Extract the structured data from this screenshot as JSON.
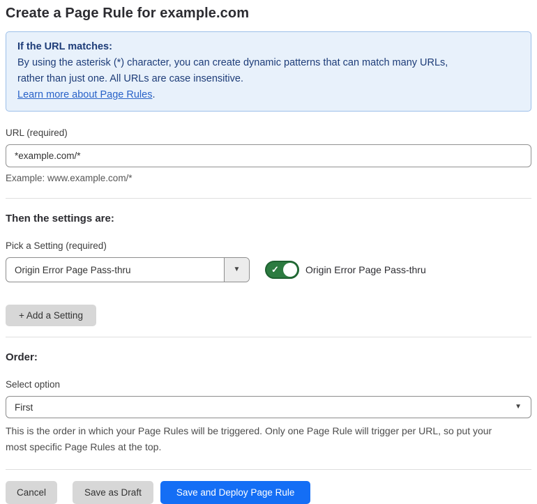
{
  "page": {
    "title": "Create a Page Rule for example.com"
  },
  "info_box": {
    "heading": "If the URL matches:",
    "body_lines": [
      "By using the asterisk (*) character, you can create dynamic patterns that can match many URLs,",
      "rather than just one. All URLs are case insensitive."
    ],
    "link_label": "Learn more about Page Rules",
    "link_suffix": "."
  },
  "url_field": {
    "label": "URL (required)",
    "value": "*example.com/*",
    "helper": "Example: www.example.com/*"
  },
  "settings_section": {
    "heading": "Then the settings are:",
    "picker_label": "Pick a Setting (required)",
    "picker_value": "Origin Error Page Pass-thru",
    "picker_arrow": "▼",
    "toggle": {
      "state": "on",
      "check_glyph": "✓",
      "label": "Origin Error Page Pass-thru"
    },
    "add_setting_label": "+ Add a Setting"
  },
  "order_section": {
    "heading": "Order:",
    "select_label": "Select option",
    "select_value": "First",
    "select_arrow": "▼",
    "helper_lines": [
      "This is the order in which your Page Rules will be triggered. Only one Page Rule will trigger per URL, so put your",
      "most specific Page Rules at the top."
    ]
  },
  "footer": {
    "cancel_label": "Cancel",
    "save_draft_label": "Save as Draft",
    "save_deploy_label": "Save and Deploy Page Rule"
  },
  "colors": {
    "primary_blue": "#146ef5",
    "info_bg": "#e8f1fb",
    "info_border": "#9cbfe9",
    "info_text": "#1d3c78",
    "link_blue": "#2862c8",
    "toggle_green": "#2c7b40",
    "button_gray": "#d7d7d7"
  }
}
